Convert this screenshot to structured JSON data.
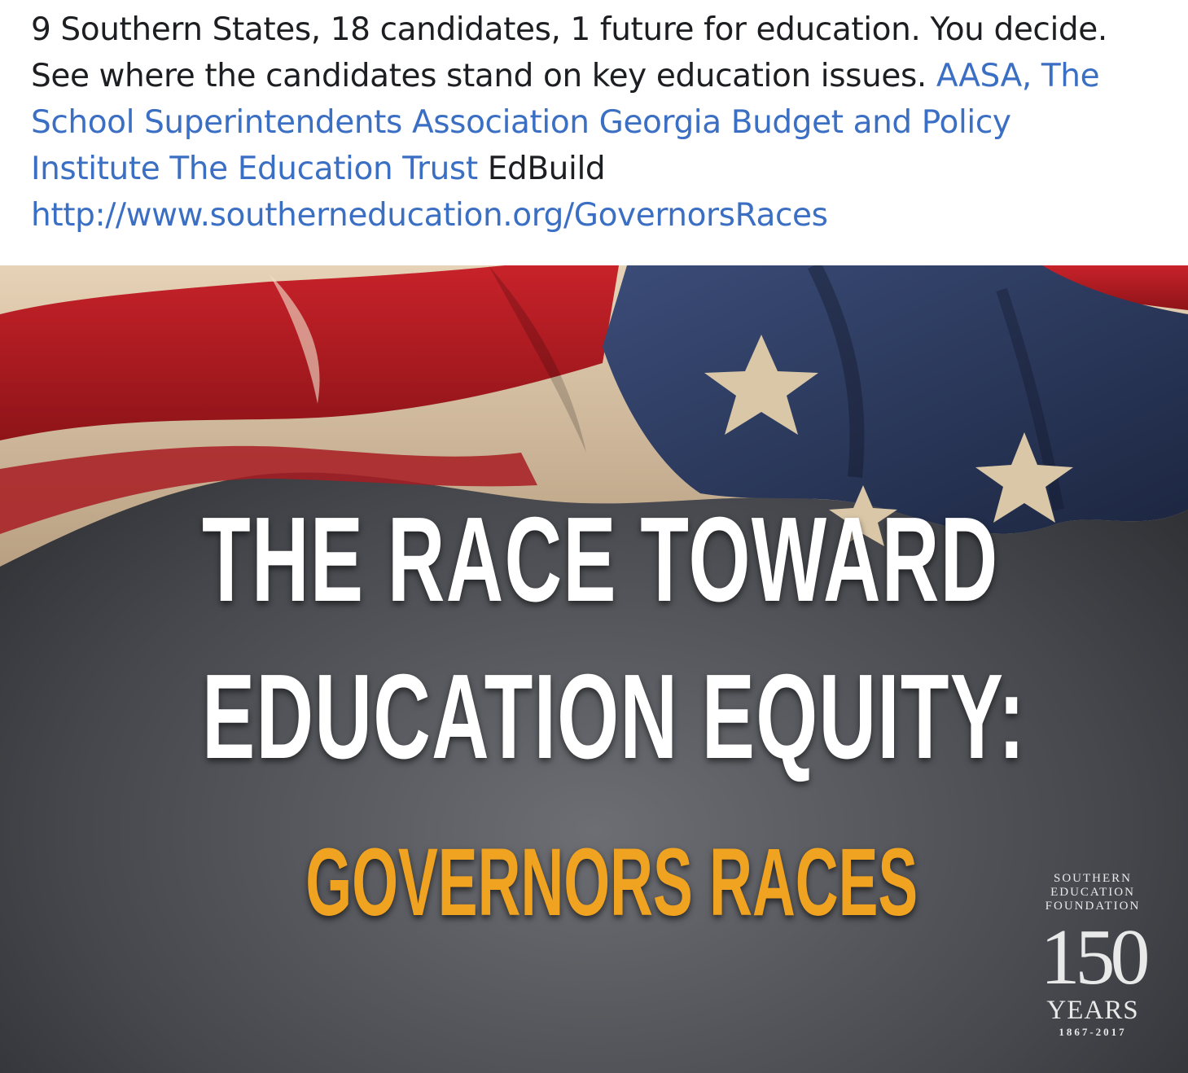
{
  "post": {
    "text_line1": "9 Southern States, 18 candidates, 1 future for education. You decide.",
    "text_line2": "See where the candidates stand on key education issues. ",
    "tag_aasa_part1": "AASA, The",
    "tag_aasa_part2": "School Superintendents Association",
    "tag_gbpi_part1": "Georgia Budget and Policy",
    "tag_gbpi_part2": "Institute",
    "tag_edtrust": "The Education Trust",
    "edbuild": "EdBuild",
    "link": "http://www.southerneducation.org/GovernorsRaces",
    "link_color": "#3b6fc4"
  },
  "image": {
    "headline_line1": "THE RACE TOWARD",
    "headline_line2": "EDUCATION EQUITY:",
    "subhead": "GOVERNORS RACES",
    "subhead_color": "#f0a321",
    "logo": {
      "line1": "SOUTHERN",
      "line2": "EDUCATION",
      "line3": "FOUNDATION",
      "number": "150",
      "years": "YEARS",
      "range": "1867-2017"
    }
  }
}
